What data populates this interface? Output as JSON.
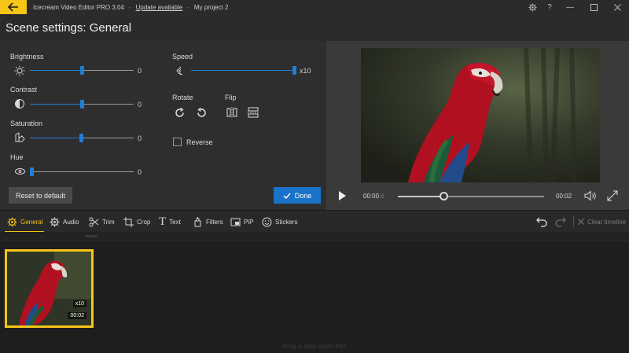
{
  "titlebar": {
    "app_name": "Icecream Video Editor PRO 3.04",
    "separator": "-",
    "update_link": "Update available",
    "project_name": "My project 2"
  },
  "scene": {
    "title": "Scene settings: General"
  },
  "settings": {
    "brightness": {
      "label": "Brightness",
      "value": "0",
      "icon": "brightness-icon",
      "level_fraction": 0.5
    },
    "contrast": {
      "label": "Contrast",
      "value": "0",
      "icon": "contrast-icon",
      "level_fraction": 0.5
    },
    "saturation": {
      "label": "Saturation",
      "value": "0",
      "icon": "saturation-icon",
      "level_fraction": 0.5
    },
    "hue": {
      "label": "Hue",
      "value": "0",
      "icon": "hue-icon",
      "level_fraction": 0.0
    },
    "speed": {
      "label": "Speed",
      "value": "x10",
      "icon": "speed-icon",
      "level_fraction": 1.0
    },
    "rotate": {
      "label": "Rotate"
    },
    "flip": {
      "label": "Flip"
    },
    "reverse": {
      "label": "Reverse",
      "checked": false
    },
    "reset_label": "Reset to default",
    "done_label": "Done"
  },
  "preview": {
    "current_time": "00:00",
    "current_time_suffix": ".6",
    "duration": "00:02",
    "progress_fraction": 0.31
  },
  "toolbar": {
    "tools": [
      {
        "label": "General",
        "icon": "gear-icon",
        "active": true
      },
      {
        "label": "Audio",
        "icon": "audio-gear-icon",
        "active": false
      },
      {
        "label": "Trim",
        "icon": "scissors-icon",
        "active": false
      },
      {
        "label": "Crop",
        "icon": "crop-icon",
        "active": false
      },
      {
        "label": "Text",
        "icon": "text-icon",
        "active": false
      },
      {
        "label": "Filters",
        "icon": "filters-icon",
        "active": false
      },
      {
        "label": "PiP",
        "icon": "pip-icon",
        "active": false
      },
      {
        "label": "Stickers",
        "icon": "stickers-icon",
        "active": false
      }
    ],
    "clear_label": "Clear timeline"
  },
  "timeline": {
    "clip": {
      "speed_badge": "x10",
      "duration_badge": "00:02"
    },
    "audio_hint": "Drag & drop audio files"
  },
  "colors": {
    "accent_yellow": "#f5c518",
    "accent_blue": "#1a73c9",
    "panel": "#2e2e2e",
    "background": "#1f1f1f"
  }
}
